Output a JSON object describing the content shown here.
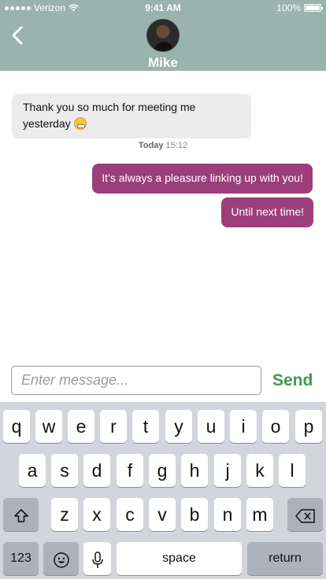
{
  "status_bar": {
    "carrier": "Verizon",
    "time": "9:41 AM",
    "battery": "100%"
  },
  "header": {
    "contact_name": "Mike"
  },
  "messages": {
    "incoming": {
      "text": "Thank you so much for meeting me yesterday"
    },
    "timestamp": {
      "day": "Today",
      "time": "15:12"
    },
    "outgoing": [
      {
        "text": "It’s always a pleasure linking up with you!"
      },
      {
        "text": "Until next time!"
      }
    ]
  },
  "composer": {
    "placeholder": "Enter message...",
    "send_label": "Send"
  },
  "keyboard": {
    "row1": [
      "q",
      "w",
      "e",
      "r",
      "t",
      "y",
      "u",
      "i",
      "o",
      "p"
    ],
    "row2": [
      "a",
      "s",
      "d",
      "f",
      "g",
      "h",
      "j",
      "k",
      "l"
    ],
    "row3": [
      "z",
      "x",
      "c",
      "v",
      "b",
      "n",
      "m"
    ],
    "numbers_label": "123",
    "space_label": "space",
    "return_label": "return"
  },
  "icons": {
    "back": "chevron-left-icon",
    "shift": "shift-arrow-icon",
    "delete": "backspace-icon",
    "emoji": "emoji-icon",
    "mic": "microphone-icon",
    "wifi": "wifi-icon",
    "battery": "battery-icon"
  },
  "colors": {
    "header": "#9ab3ad",
    "outgoing_bubble": "#9c3e7b",
    "incoming_bubble": "#ececec",
    "send": "#3a9a55"
  }
}
